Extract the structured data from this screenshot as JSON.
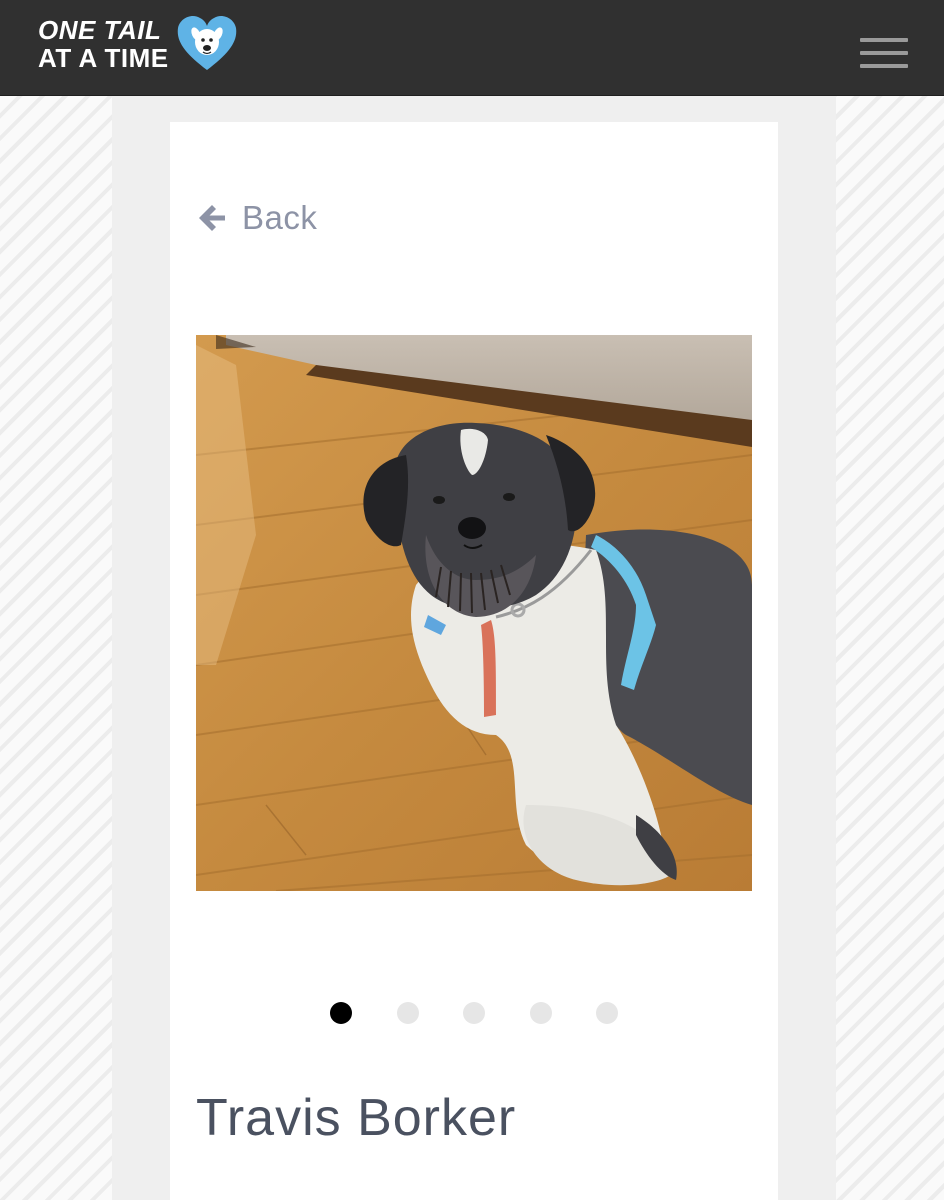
{
  "header": {
    "logo_line1": "ONE TAIL",
    "logo_line2": "AT A TIME",
    "logo_icon": "dog-heart-icon",
    "menu_icon": "hamburger-menu-icon"
  },
  "nav": {
    "back_label": "Back",
    "back_icon": "arrow-left-icon"
  },
  "gallery": {
    "image_alt": "Travis Borker",
    "slide_count": 5,
    "active_slide": 1
  },
  "pet": {
    "name": "Travis Borker"
  },
  "colors": {
    "header_bg": "#303030",
    "heart_blue": "#5fb3e6",
    "text_muted": "#8d93a6",
    "name_color": "#4a5160",
    "dot_active": "#000000",
    "dot_inactive": "#e6e6e6"
  }
}
